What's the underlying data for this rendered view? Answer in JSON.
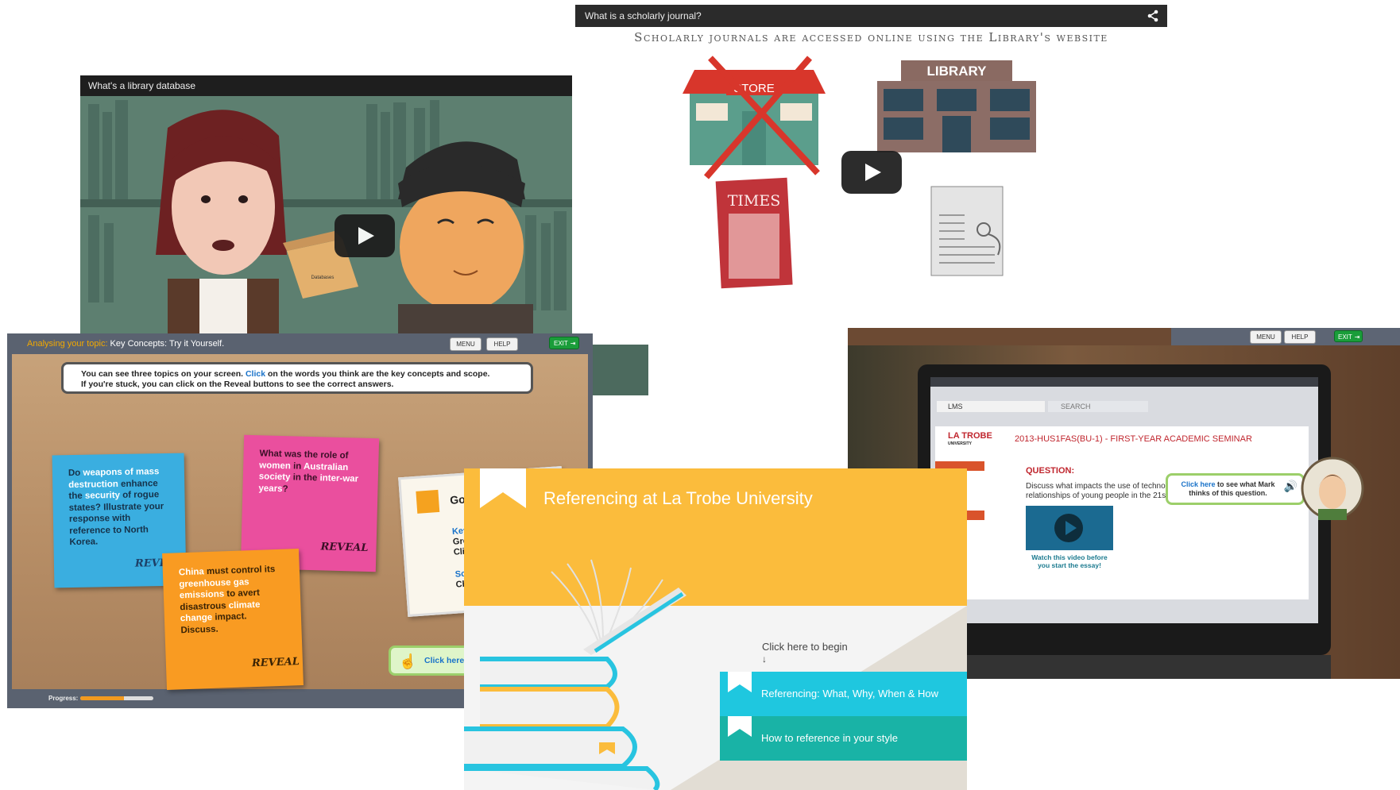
{
  "journal_video": {
    "title": "What is a scholarly journal?",
    "subtitle": "Scholarly journals are accessed online using the Library's website",
    "store_sign": "STORE",
    "library_sign": "LIBRARY",
    "magazine_title": "TIMES",
    "icons": [
      "share-icon",
      "play-icon"
    ]
  },
  "database_video": {
    "title": "What's a library database",
    "box_label": "Databases",
    "icons": [
      "play-icon"
    ]
  },
  "concepts": {
    "breadcrumb_topic": "Analysing your topic:",
    "breadcrumb_rest": " Key Concepts: Try it Yourself.",
    "menu_label": "MENU",
    "help_label": "HELP",
    "exit_label": "EXIT",
    "instruction_line1_a": "You can see three topics on your screen. ",
    "instruction_click": "Click",
    "instruction_line1_b": " on the words you think are the key concepts and scope.",
    "instruction_line2": "If you're stuck, you can click on the Reveal buttons to see the correct answers.",
    "note_blue": {
      "p1": "Do ",
      "h1": "weapons of mass destruction",
      "p2": " enhance the ",
      "h2": "security",
      "p3": " of rogue states? Illustrate your response with reference to North Korea."
    },
    "note_pink": {
      "p1": "What was the role of ",
      "h1": "women",
      "p2": " in ",
      "h2": "Australian society",
      "p3": " in the ",
      "h3": "inter-war years",
      "p4": "?"
    },
    "note_orange": {
      "h1": "China",
      "p1": " must control its ",
      "h2": "greenhouse gas emissions",
      "p2": " to avert disastrous ",
      "h3": "climate change",
      "p3": " impact. Discuss."
    },
    "reveal_label": "REVEAL",
    "card_heading": "Good",
    "card_key_label": "Key C",
    "card_key_line1": "Green",
    "card_key_line2": "Clima",
    "card_scope_label": "Scop",
    "card_scope_line1": "China",
    "click_here_label": "Click here t",
    "progress_label": "Progress:",
    "progress_fraction": 0.6,
    "icons": [
      "exit-icon",
      "hand-pointer-icon"
    ]
  },
  "referencing": {
    "title": "Referencing at La Trobe University",
    "begin_prompt": "Click here to begin",
    "begin_arrow": "↓",
    "button1": "Referencing: What, Why, When & How",
    "button2": "How to reference in your style",
    "colors": {
      "header": "#fbbc3c",
      "button1": "#1fc7df",
      "button2": "#19b3a6"
    },
    "icons": [
      "bookmark-icon"
    ]
  },
  "lms": {
    "menu_label": "MENU",
    "help_label": "HELP",
    "exit_label": "EXIT",
    "tab_lms": "LMS",
    "tab_search": "SEARCH",
    "university_name": "LA TROBE",
    "university_sub": "UNIVERSITY",
    "course_title": "2013-HUS1FAS(BU-1) - FIRST-YEAR ACADEMIC SEMINAR",
    "question_heading": "QUESTION:",
    "question_text": "Discuss what impacts the use of technology has had on the relationships of young people in the 21st century.\"",
    "video_caption": "Watch this video before you start the essay!",
    "callout_link": "Click here",
    "callout_rest": " to see what Mark thinks of this question.",
    "icons": [
      "speaker-icon",
      "play-icon",
      "exit-icon"
    ]
  }
}
